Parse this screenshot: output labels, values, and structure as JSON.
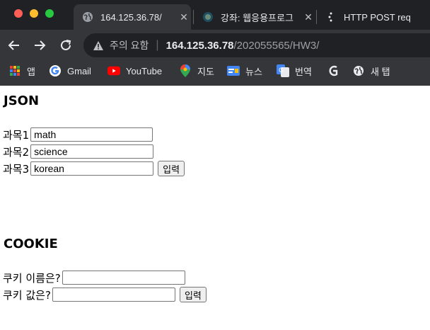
{
  "tabs": [
    {
      "title": "164.125.36.78/",
      "favicon": "globe-icon"
    },
    {
      "title": "강좌: 웹응용프로그",
      "favicon": "moodle-icon"
    },
    {
      "title": "HTTP POST req",
      "favicon": "postman-icon"
    }
  ],
  "address_bar": {
    "warning_text": "주의 요함",
    "host": "164.125.36.78",
    "path": "/202055565/HW3/"
  },
  "bookmarks": [
    {
      "label": "앱",
      "icon": "apps-grid-icon"
    },
    {
      "label": "Gmail",
      "icon": "google-icon"
    },
    {
      "label": "YouTube",
      "icon": "youtube-icon"
    },
    {
      "label": "지도",
      "icon": "maps-pin-icon"
    },
    {
      "label": "뉴스",
      "icon": "google-news-icon"
    },
    {
      "label": "번역",
      "icon": "translate-icon"
    },
    {
      "label": "",
      "icon": "g-logo-icon"
    },
    {
      "label": "새 탭",
      "icon": "globe-icon"
    }
  ],
  "json_section": {
    "heading": "JSON",
    "fields": [
      {
        "label": "과목1",
        "value": "math"
      },
      {
        "label": "과목2",
        "value": "science"
      },
      {
        "label": "과목3",
        "value": "korean"
      }
    ],
    "submit_label": "입력"
  },
  "cookie_section": {
    "heading": "COOKIE",
    "fields": [
      {
        "label": "쿠키 이름은?",
        "value": ""
      },
      {
        "label": "쿠키 값은?",
        "value": ""
      }
    ],
    "submit_label": "입력"
  },
  "colors": {
    "chrome_dark": "#202124",
    "toolbar": "#35363a",
    "close_red": "#ff5f57",
    "min_yellow": "#febc2e",
    "max_green": "#28c840"
  }
}
